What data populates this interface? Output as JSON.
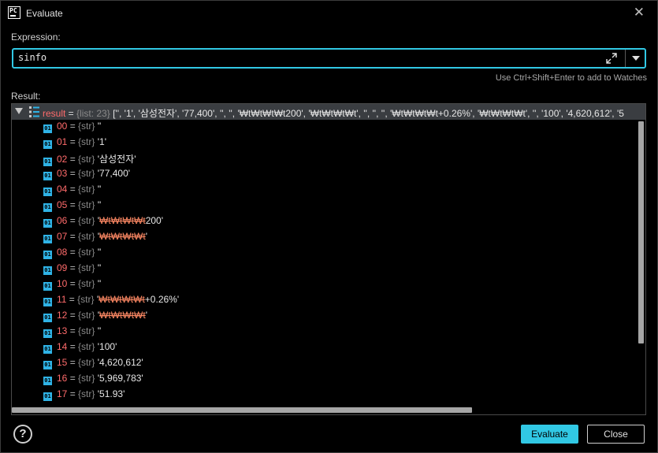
{
  "window": {
    "title": "Evaluate",
    "app_icon_text": "PC"
  },
  "expression": {
    "label": "Expression:",
    "value": "sinfo"
  },
  "hint": "Use Ctrl+Shift+Enter to add to Watches",
  "result": {
    "label": "Result:",
    "root": {
      "name": "result",
      "eq": " = ",
      "type": "{list: 23}",
      "summary": " ['', '1', '삼성전자', '77,400', '', '', '₩t₩t₩t₩t200', '₩t₩t₩t₩t', '', '', '', '₩t₩t₩t₩t+0.26%', '₩t₩t₩t₩t', '', '100', '4,620,612', '5"
    },
    "items": [
      {
        "idx": "00",
        "type": "{str}",
        "value": "''"
      },
      {
        "idx": "01",
        "type": "{str}",
        "value": "'1'"
      },
      {
        "idx": "02",
        "type": "{str}",
        "value": "'삼성전자'"
      },
      {
        "idx": "03",
        "type": "{str}",
        "value": "'77,400'"
      },
      {
        "idx": "04",
        "type": "{str}",
        "value": "''"
      },
      {
        "idx": "05",
        "type": "{str}",
        "value": "''"
      },
      {
        "idx": "06",
        "type": "{str}",
        "value": "'₩t₩t₩t₩t200'"
      },
      {
        "idx": "07",
        "type": "{str}",
        "value": "'₩t₩t₩t₩t'"
      },
      {
        "idx": "08",
        "type": "{str}",
        "value": "''"
      },
      {
        "idx": "09",
        "type": "{str}",
        "value": "''"
      },
      {
        "idx": "10",
        "type": "{str}",
        "value": "''"
      },
      {
        "idx": "11",
        "type": "{str}",
        "value": "'₩t₩t₩t₩t+0.26%'"
      },
      {
        "idx": "12",
        "type": "{str}",
        "value": "'₩t₩t₩t₩t'"
      },
      {
        "idx": "13",
        "type": "{str}",
        "value": "''"
      },
      {
        "idx": "14",
        "type": "{str}",
        "value": "'100'"
      },
      {
        "idx": "15",
        "type": "{str}",
        "value": "'4,620,612'"
      },
      {
        "idx": "16",
        "type": "{str}",
        "value": "'5,969,783'"
      },
      {
        "idx": "17",
        "type": "{str}",
        "value": "'51.93'"
      }
    ]
  },
  "buttons": {
    "help": "?",
    "evaluate": "Evaluate",
    "close": "Close"
  },
  "colors": {
    "accent": "#31c8e4",
    "name": "#ff6b6b",
    "type": "#8a8a8a",
    "root_row_bg": "#3a3d41"
  }
}
